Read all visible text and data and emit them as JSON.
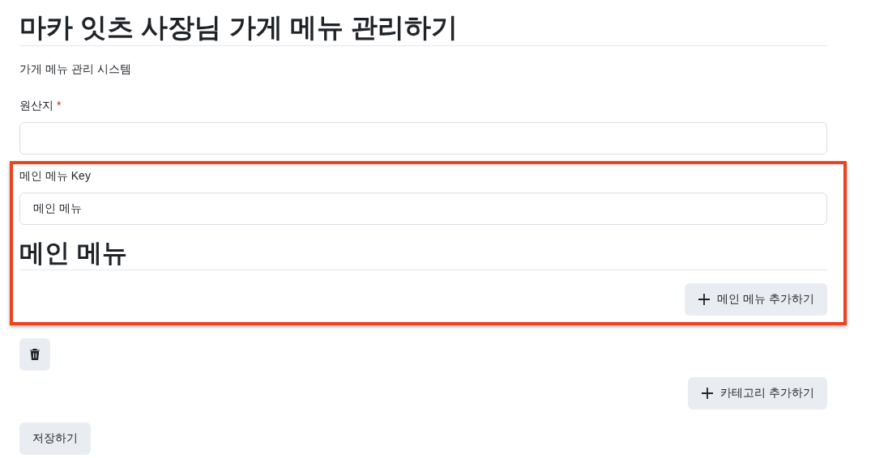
{
  "title": "마카 잇츠 사장님 가게 메뉴 관리하기",
  "subtitle": "가게 메뉴 관리 시스템",
  "origin_field": {
    "label": "원산지",
    "required_mark": "*"
  },
  "main_menu_section": {
    "highlighted": true,
    "key_field": {
      "label": "메인 메뉴 Key",
      "value": "메인 메뉴"
    },
    "heading": "메인 메뉴",
    "add_button": "메인 메뉴 추가하기"
  },
  "add_category_button": "카테고리 추가하기",
  "save_button": "저장하기"
}
